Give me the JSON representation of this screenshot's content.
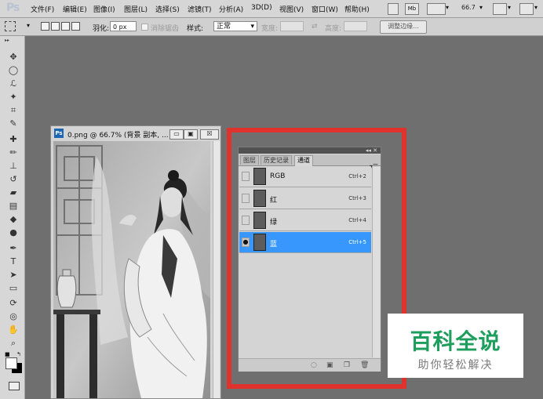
{
  "app": {
    "logo": "Ps"
  },
  "menubar": {
    "items": [
      "文件(F)",
      "编辑(E)",
      "图像(I)",
      "图层(L)",
      "选择(S)",
      "滤镜(T)",
      "分析(A)",
      "3D(D)",
      "视图(V)",
      "窗口(W)",
      "帮助(H)"
    ],
    "zoom": "66.7",
    "icons": [
      "bridge-icon",
      "minibridge-icon",
      "view-extras-icon",
      "zoom-level-icon",
      "arrange-documents-icon",
      "screen-mode-icon"
    ]
  },
  "options": {
    "feather_label": "羽化:",
    "feather_value": "0 px",
    "antialias_label": "消除锯齿",
    "style_label": "样式:",
    "style_value": "正常",
    "width_label": "宽度:",
    "height_label": "高度:",
    "refine_edge": "调整边缘..."
  },
  "document": {
    "title": "0.png @ 66.7% (背景 副本, ...",
    "ps_badge": "Ps",
    "minimize": "▭",
    "maximize": "▣",
    "close": "☒"
  },
  "channels_panel": {
    "tabs": [
      "图层",
      "历史记录",
      "通道"
    ],
    "active_tab": "通道",
    "collapse_icon": "◂◂ ✕",
    "menu_icon": "▾☰",
    "channels": [
      {
        "name": "RGB",
        "shortcut": "Ctrl+2",
        "visible": false,
        "selected": false
      },
      {
        "name": "红",
        "shortcut": "Ctrl+3",
        "visible": false,
        "selected": false
      },
      {
        "name": "绿",
        "shortcut": "Ctrl+4",
        "visible": false,
        "selected": false
      },
      {
        "name": "蓝",
        "shortcut": "Ctrl+5",
        "visible": true,
        "selected": true
      }
    ],
    "bottom_icons": [
      "load-selection-icon",
      "save-selection-icon",
      "new-channel-icon",
      "delete-channel-icon"
    ]
  },
  "watermark": {
    "title": "百科全说",
    "subtitle": "助你轻松解决"
  },
  "colors": {
    "accent_red": "#e0322c",
    "selection_blue": "#3797fd",
    "watermark_green": "#1e9e5c"
  }
}
